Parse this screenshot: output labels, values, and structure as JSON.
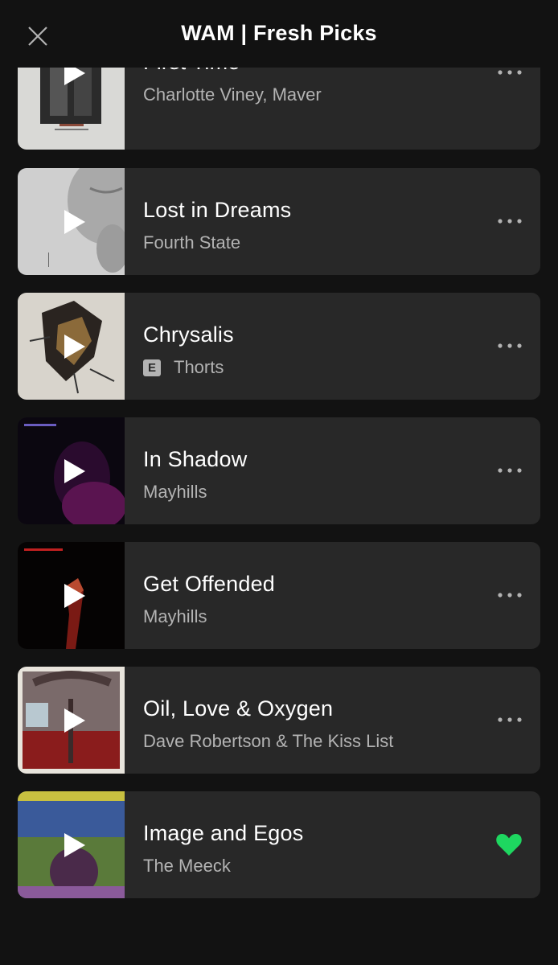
{
  "header": {
    "title": "WAM | Fresh Picks",
    "close_icon": "close-icon"
  },
  "tracks": [
    {
      "title": "First Time",
      "artist": "Charlotte Viney, Maver",
      "explicit": false,
      "action": "more"
    },
    {
      "title": "Lost in Dreams",
      "artist": "Fourth State",
      "explicit": false,
      "action": "more"
    },
    {
      "title": "Chrysalis",
      "artist": "Thorts",
      "explicit": true,
      "explicit_label": "E",
      "action": "more"
    },
    {
      "title": "In Shadow",
      "artist": "Mayhills",
      "explicit": false,
      "action": "more"
    },
    {
      "title": "Get Offended",
      "artist": "Mayhills",
      "explicit": false,
      "action": "more"
    },
    {
      "title": "Oil, Love & Oxygen",
      "artist": "Dave Robertson & The Kiss List",
      "explicit": false,
      "action": "more"
    },
    {
      "title": "Image and Egos",
      "artist": "The Meeck",
      "explicit": false,
      "action": "liked"
    }
  ],
  "colors": {
    "background": "#121212",
    "card": "#282828",
    "text_primary": "#ffffff",
    "text_secondary": "#b3b3b3",
    "liked_heart": "#1ed760"
  }
}
